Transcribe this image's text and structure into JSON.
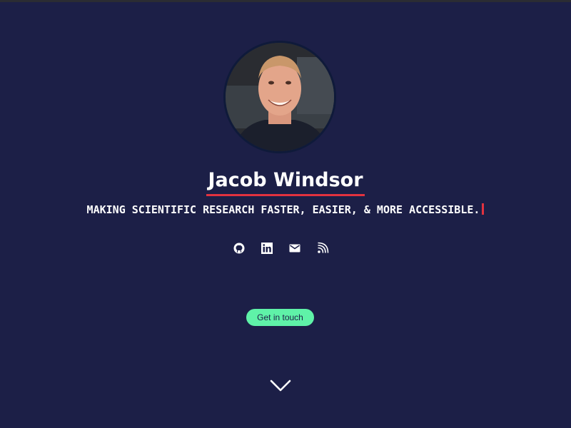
{
  "profile": {
    "name": "Jacob Windsor",
    "tagline": "MAKING SCIENTIFIC RESEARCH FASTER, EASIER, & MORE ACCESSIBLE.",
    "avatar_alt": "photo of Jacob Windsor"
  },
  "social": [
    {
      "icon": "github-icon"
    },
    {
      "icon": "linkedin-icon"
    },
    {
      "icon": "email-icon"
    },
    {
      "icon": "rss-icon"
    }
  ],
  "cta": {
    "label": "Get in touch"
  },
  "scroll": {
    "icon": "chevron-down-icon"
  },
  "colors": {
    "background": "#1c1f47",
    "accent_red": "#e2323f",
    "button_green": "#5ff2a8",
    "text": "#ffffff"
  }
}
